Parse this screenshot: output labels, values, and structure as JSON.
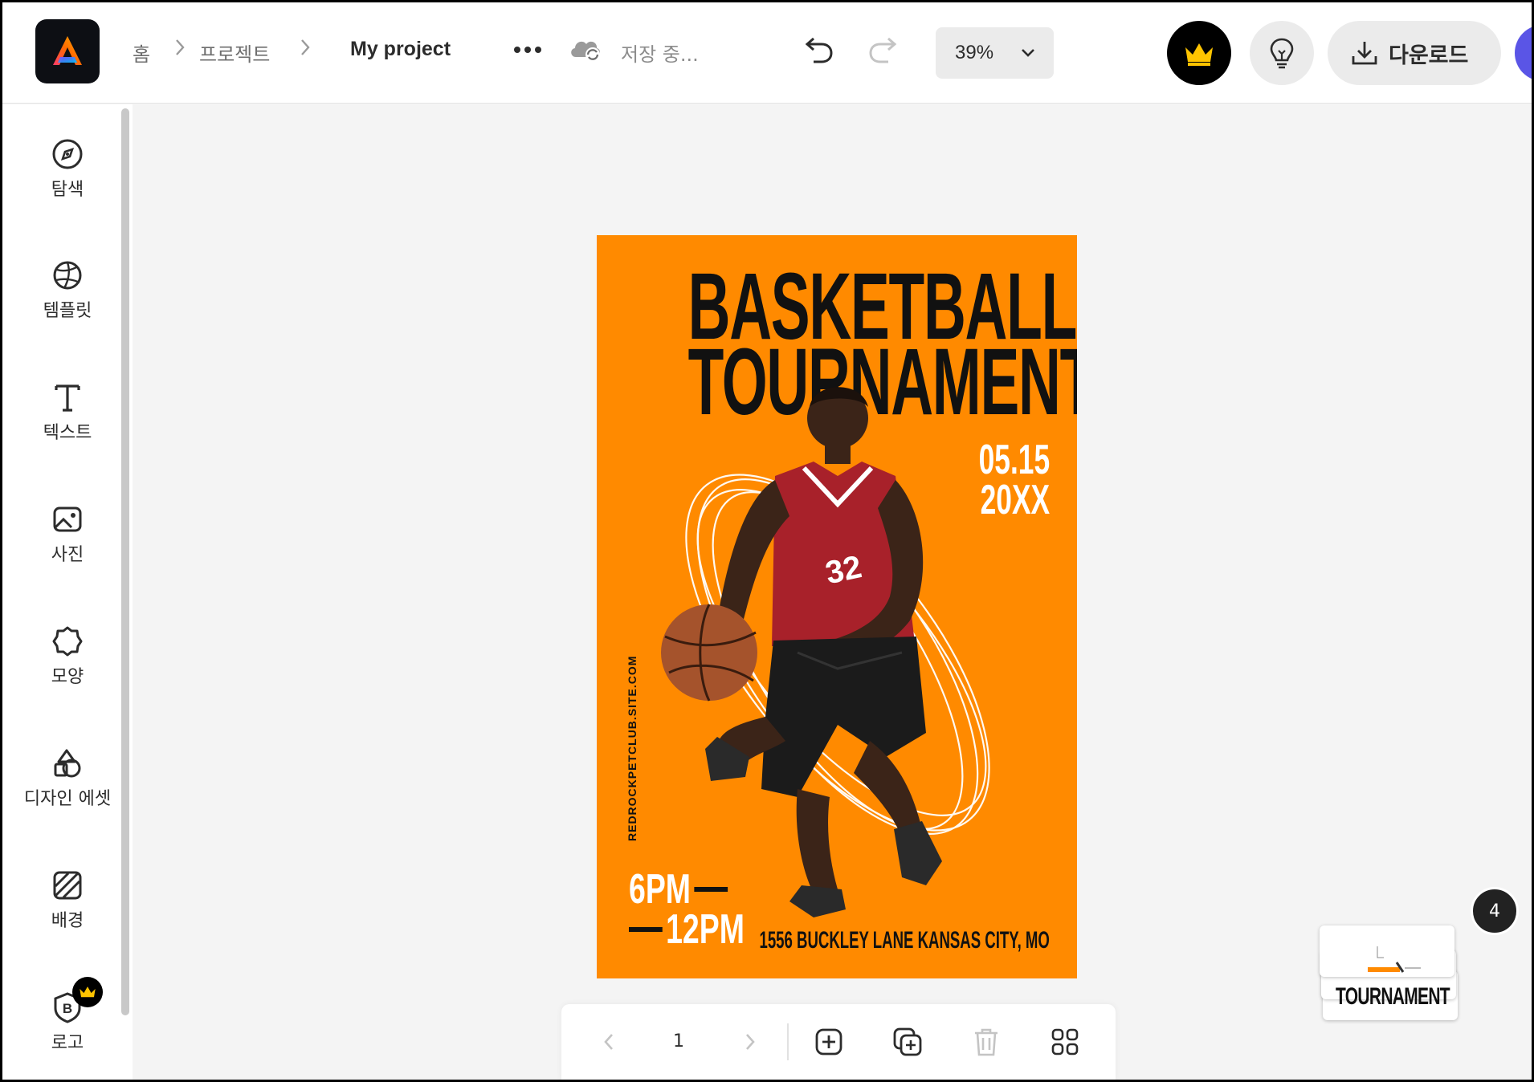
{
  "breadcrumb": {
    "home": "홈",
    "projects": "프로젝트",
    "current": "My project"
  },
  "header": {
    "save_status": "저장 중...",
    "zoom": "39%",
    "download_label": "다운로드"
  },
  "icons": {
    "logo": "adobe-express-logo",
    "more": "more-horizontal-icon",
    "cloud": "cloud-sync-icon",
    "undo": "undo-icon",
    "redo": "redo-icon",
    "chevron": "chevron-down-icon",
    "premium": "crown-icon",
    "ideas": "lightbulb-icon",
    "download": "download-icon"
  },
  "sidebar": {
    "items": [
      {
        "label": "탐색",
        "icon": "compass-icon"
      },
      {
        "label": "템플릿",
        "icon": "template-icon"
      },
      {
        "label": "텍스트",
        "icon": "text-icon"
      },
      {
        "label": "사진",
        "icon": "photo-icon"
      },
      {
        "label": "모양",
        "icon": "shape-icon"
      },
      {
        "label": "디자인 에셋",
        "icon": "design-assets-icon"
      },
      {
        "label": "배경",
        "icon": "background-icon"
      },
      {
        "label": "로고",
        "icon": "brand-logo-icon"
      }
    ]
  },
  "poster": {
    "title_line1": "BASKETBALL",
    "title_line2": "TOURNAMENT",
    "date_line1": "05.15",
    "date_line2": "20XX",
    "url": "REDROCKPETCLUB.SITE.COM",
    "time_start": "6PM",
    "time_end": "12PM",
    "address": "1556 BUCKLEY LANE KANSAS CITY, MO",
    "jersey_number": "32",
    "background_color": "#ff8a00"
  },
  "page_toolbar": {
    "current_page": "1"
  },
  "page_stack": {
    "count": "4",
    "thumbnail_text": "TOURNAMENT"
  },
  "colors": {
    "accent_avatar": "#5a55e6",
    "poster_orange": "#ff8a00"
  }
}
